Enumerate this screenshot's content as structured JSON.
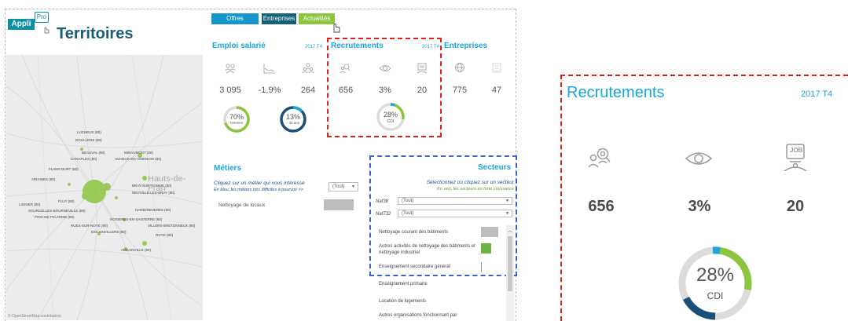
{
  "logo": {
    "appli": "Appli",
    "pro": "Pro"
  },
  "app_title": "Territoires",
  "tabs": {
    "offres": "Offres",
    "entreprises": "Entreprises",
    "actualites": "Actualités"
  },
  "emploi": {
    "title": "Emploi salarié",
    "period": "2017 T4",
    "values": [
      "3 095",
      "-1,9%",
      "264"
    ],
    "donut1": {
      "value": "70%",
      "label": "femmes",
      "fraction": 0.7
    },
    "donut2": {
      "value": "13%",
      "label": "- 30 ans",
      "fraction": 0.13
    }
  },
  "recrutements": {
    "title": "Recrutements",
    "period": "2017 T4",
    "values": [
      "656",
      "3%",
      "20"
    ],
    "donut": {
      "value": "28%",
      "label": "CDI",
      "fraction": 0.28
    },
    "job_icon_text": "JOB"
  },
  "entreprises": {
    "title": "Entreprises",
    "values": [
      "775",
      "47"
    ]
  },
  "metiers": {
    "title": "Métiers",
    "prompt": "Cliquez sur un métier qui vous intéresse",
    "hint": "En bleu, les métiers très difficiles à pourvoir >>",
    "filter": "(Tout)",
    "item": "Nettoyage de locaux"
  },
  "secteurs": {
    "title": "Secteurs",
    "prompt": "Sélectionnez ou cliquez sur un secteur",
    "hint": "En vert, les secteurs en forte croissance",
    "naf38_label": "Naf38",
    "naf38_value": "(Tout)",
    "naf732_label": "Naf732",
    "naf732_value": "(Tout)",
    "items": [
      "Nettoyage courant des bâtiments",
      "Autres activités de nettoyage des bâtiments et nettoyage industriel",
      "Enseignement secondaire général",
      "Enseignement primaire",
      "Location de logements",
      "Autres organisations fonctionnant par"
    ]
  },
  "map": {
    "region": "Hauts-de-Fran",
    "attribution": "© OpenStreetMap contributors",
    "towns": [
      "LUCHEUX (80)",
      "DOULLENS (80)",
      "BEAUVAL (80)",
      "MIRAUMONT (80)",
      "CANAPLES (80)",
      "ACHEUX-EN-AMIENOIS (80)",
      "FLIXECOURT (80)",
      "BRAY-SUR-SOMME (80)",
      "AIRAINES (80)",
      "NEUVILLE-LES-BRAY (80)",
      "FLUY (80)",
      "LIGNIER (80)",
      "SOURCELLES-BOURNEVILLE (80)",
      "POIX-DE-PICARDIE (80)",
      "HARBONNIERES (80)",
      "RUES-SUR-NOYE (80)",
      "ROSIERES-EN-SANTERRE (80)",
      "VILLERS-BRETONNEUX (80)",
      "ESCAINVILLERS (80)",
      "ROYE (80)",
      "ABBAINVILLE (80)"
    ]
  },
  "colors": {
    "blue": "#1aa6d8",
    "navy": "#1c4e7a",
    "green": "#8cc63f",
    "red": "#e0211c",
    "dashblue": "#3a63c9"
  }
}
